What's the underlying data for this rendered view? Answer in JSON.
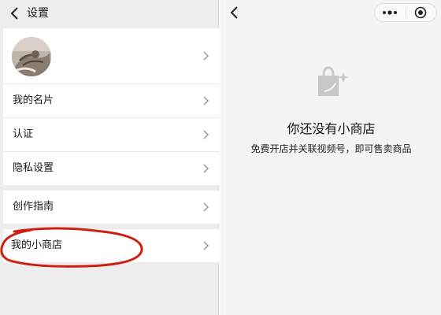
{
  "settings": {
    "title": "设置",
    "items": [
      {
        "label": "我的名片"
      },
      {
        "label": "认证"
      },
      {
        "label": "隐私设置"
      },
      {
        "label": "创作指南"
      },
      {
        "label": "我的小商店"
      }
    ]
  },
  "shop": {
    "empty_title": "你还没有小商店",
    "empty_desc": "免费开店并关联视频号，即可售卖商品"
  },
  "icons": {
    "back": "chevron-left-icon",
    "more": "more-dots-icon",
    "close": "target-circle-icon",
    "shop": "shopping-bag-icon"
  },
  "colors": {
    "annotation": "#cc2010",
    "background": "#ededed"
  }
}
